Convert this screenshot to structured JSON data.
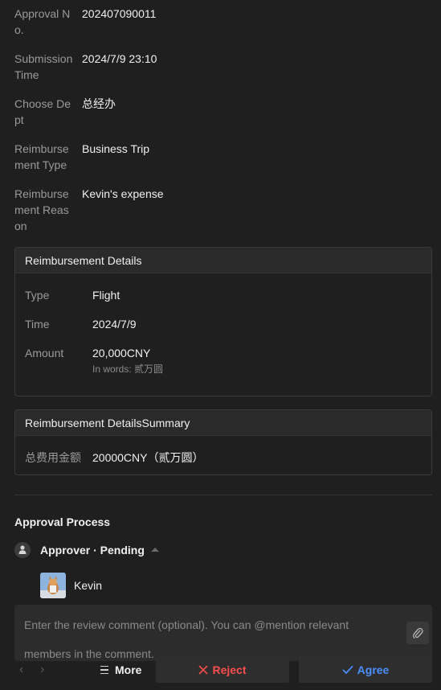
{
  "info": [
    {
      "label": "Approval No.",
      "value": "202407090011"
    },
    {
      "label": "Submission Time",
      "value": "2024/7/9 23:10"
    },
    {
      "label": "Choose Dept",
      "value": "总经办"
    },
    {
      "label": "Reimbursement Type",
      "value": "Business Trip"
    },
    {
      "label": "Reimbursement Reason",
      "value": "Kevin's expense"
    }
  ],
  "details": {
    "title": "Reimbursement Details",
    "type_label": "Type",
    "type_value": "Flight",
    "time_label": "Time",
    "time_value": "2024/7/9",
    "amount_label": "Amount",
    "amount_value": "20,000CNY",
    "amount_words": "In words: 贰万圆"
  },
  "summary": {
    "title": "Reimbursement DetailsSummary",
    "label": "总费用金额",
    "value": "20000CNY（贰万圆）"
  },
  "process": {
    "title": "Approval Process",
    "approver_status": "Approver · Pending",
    "approver_name": "Kevin"
  },
  "comment": {
    "placeholder": "Enter the review comment (optional). You can @mention relevant members in the comment."
  },
  "footer": {
    "prev_arrow": "‹",
    "next_arrow": "›",
    "more_label": "More",
    "reject_label": "Reject",
    "agree_label": "Agree"
  },
  "colors": {
    "reject": "#ff4d4f",
    "agree": "#4a90ff"
  }
}
